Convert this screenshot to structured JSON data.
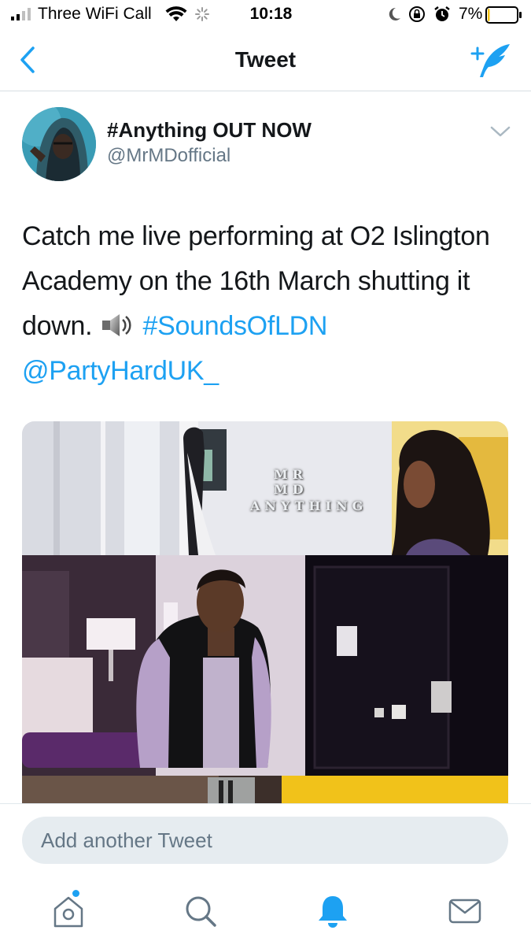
{
  "status_bar": {
    "carrier": "Three WiFi Call",
    "time": "10:18",
    "battery_percent": "7%",
    "battery_level": 0.07,
    "icons": [
      "signal-icon",
      "wifi-icon",
      "activity-spinner-icon",
      "moon-icon",
      "rotation-lock-icon",
      "alarm-icon",
      "battery-icon"
    ]
  },
  "nav": {
    "title": "Tweet",
    "back_icon": "chevron-left-icon",
    "compose_icon": "compose-tweet-icon"
  },
  "tweet": {
    "display_name": "#Anything OUT NOW",
    "handle": "@MrMDofficial",
    "text_before": "Catch me live performing at O2 Islington Academy on the 16th March shutting it down.",
    "emoji": "speaker-icon",
    "hashtag": "#SoundsOfLDN",
    "mention": "@PartyHardUK_",
    "media": {
      "caption_artist": "MR MD",
      "caption_title": "ANYTHING"
    }
  },
  "reply": {
    "placeholder": "Add another Tweet"
  },
  "tab_bar": {
    "items": [
      "home-icon",
      "search-icon",
      "notifications-icon",
      "messages-icon"
    ],
    "active": "notifications-icon"
  },
  "colors": {
    "accent": "#1da1f2",
    "text": "#14171a",
    "secondary": "#657786",
    "input_bg": "#e6ecf0"
  }
}
